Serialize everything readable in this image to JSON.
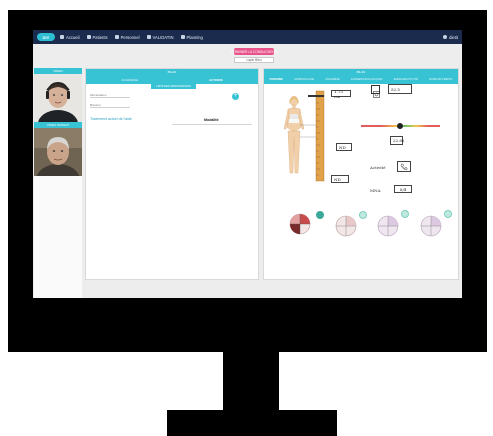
{
  "nav": {
    "logo": "DIY",
    "items": [
      {
        "label": "Accueil",
        "icon": "home-icon"
      },
      {
        "label": "Patients",
        "icon": "users-icon"
      },
      {
        "label": "Personnel",
        "icon": "building-icon"
      },
      {
        "label": "VALIDATIN",
        "icon": "grid-icon"
      },
      {
        "label": "Planning",
        "icon": "calendar-icon"
      }
    ],
    "user": "dietit"
  },
  "header": {
    "action_button": "TERMINER LA CONSULTATION",
    "select_value": "Lapin Bleu"
  },
  "video": {
    "local_label": "VIDEO",
    "remote_label": "VIDEO PATIENT"
  },
  "middle": {
    "title": "BILAN",
    "tabs": [
      "ANAMNÈSE",
      "ACTIONS"
    ],
    "sub_button": "LISTE DES ORDONNANCES",
    "fields": [
      "Alimentation",
      "Boisson"
    ],
    "link": "Traitement actuel de l'aide",
    "column_label": "Modalité"
  },
  "right": {
    "title": "BILAN",
    "tabs": [
      "POIDS/IMC",
      "MORPHOLOGIE",
      "ANAMNÈSE",
      "EXAMENS BIOLOGIQUES",
      "ENERGIE/ACTIVITÉ",
      "MODE DE PREPAS"
    ],
    "height_value": "1.73 cm",
    "weight_value": "52.5",
    "bmi_value": "22.85",
    "waist_value": "ND",
    "hip_value": "ND",
    "activity_label": "Activité",
    "mna_label": "MNA",
    "mna_value": "0/4",
    "gauge_level": 0.49
  },
  "colors": {
    "nav_bg": "#1a2b4e",
    "accent": "#38c3d4",
    "action": "#e8538a",
    "teal_badge": "#3aa99a"
  }
}
